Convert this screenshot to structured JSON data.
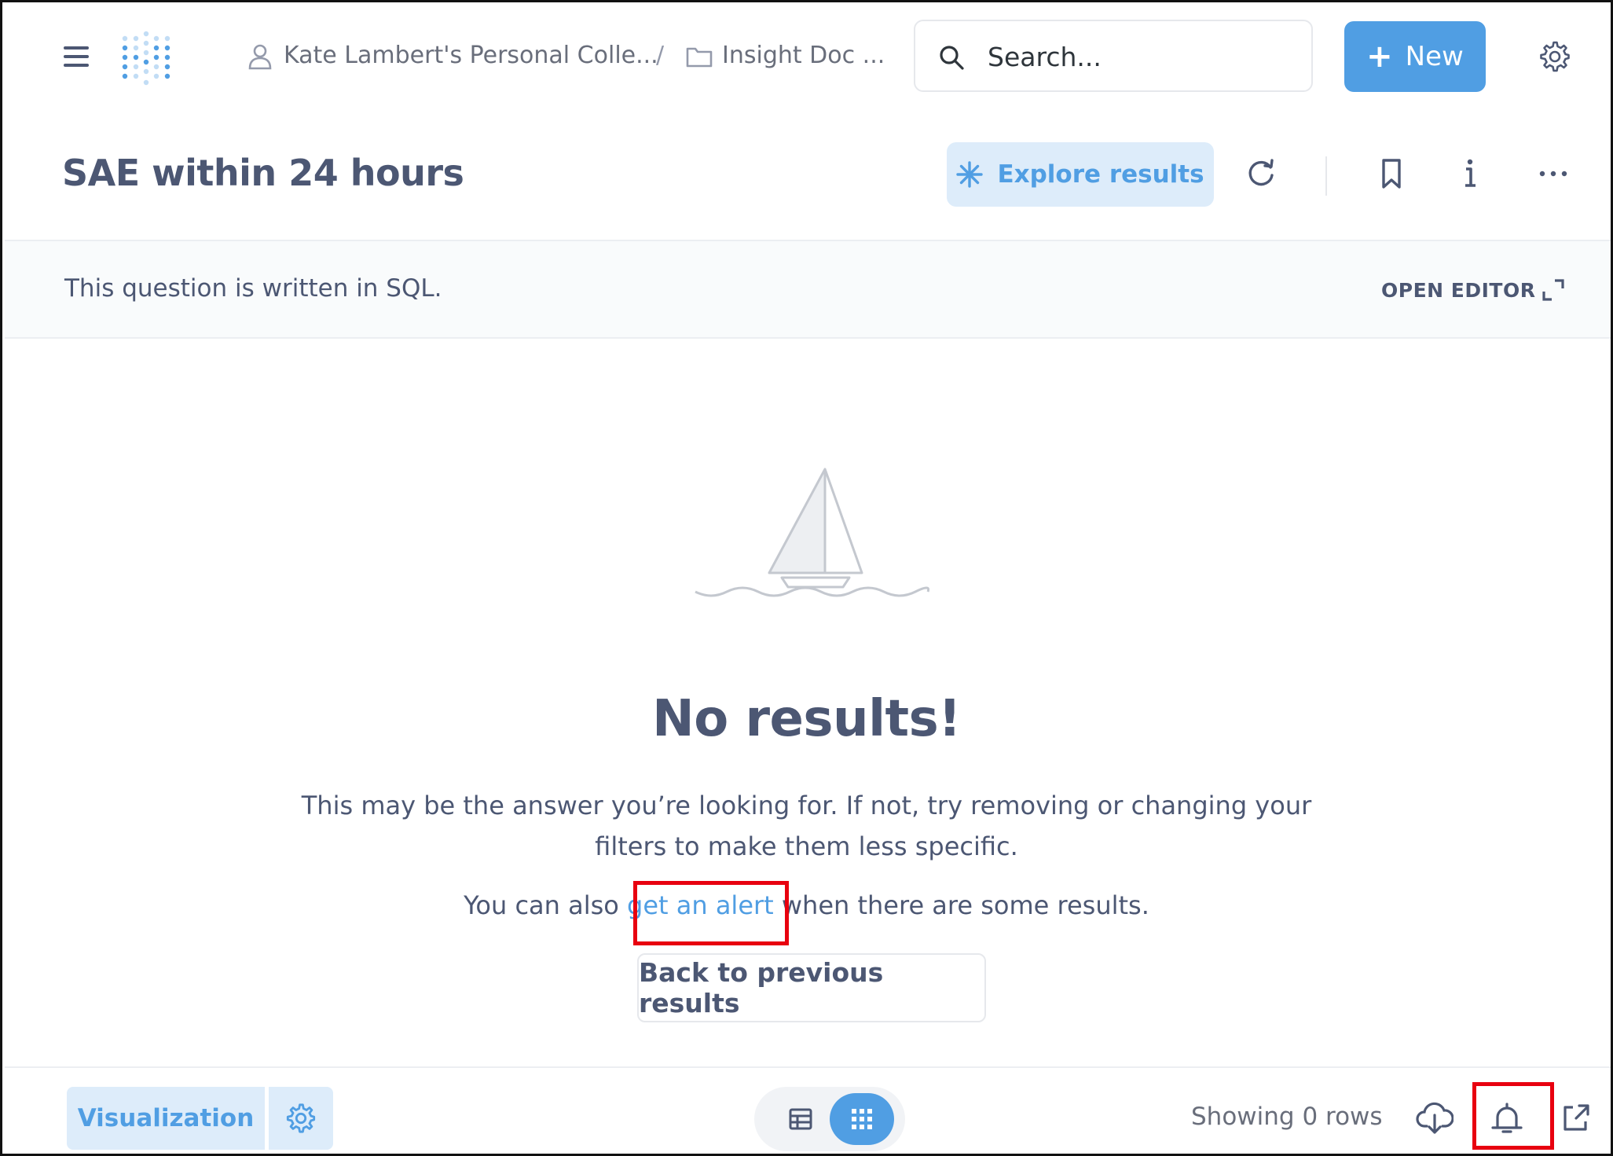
{
  "nav": {
    "breadcrumb": {
      "collection": "Kate Lambert's Personal Colle...",
      "separator": "/",
      "folder": "Insight Doc ..."
    },
    "search": {
      "placeholder": "Search..."
    },
    "new_label": "New"
  },
  "header": {
    "title": "SAE within 24 hours",
    "explore_label": "Explore results"
  },
  "sql_bar": {
    "text": "This question is written in SQL.",
    "open_editor": "OPEN EDITOR"
  },
  "empty_state": {
    "heading": "No results!",
    "desc_line1": "This may be the answer you’re looking for. If not, try removing or changing your",
    "desc_line2": "filters to make them less specific.",
    "alert_prefix": "You can also ",
    "alert_link": "get an alert",
    "alert_suffix": " when there are some results.",
    "back_label": "Back to previous results"
  },
  "footer": {
    "visualization_label": "Visualization",
    "row_count": "Showing 0 rows"
  },
  "colors": {
    "brand": "#509ee3",
    "brand_light": "#ddecfa",
    "text_dark": "#4c5773",
    "text_medium": "#696e7b",
    "highlight": "#e8000f"
  },
  "icons": [
    "menu-icon",
    "metabase-logo",
    "person-icon",
    "folder-icon",
    "search-icon",
    "plus-icon",
    "gear-icon",
    "sparkle-icon",
    "refresh-icon",
    "bookmark-icon",
    "info-icon",
    "ellipsis-icon",
    "expand-icon",
    "sailboat-illustration",
    "table-icon",
    "grid-icon",
    "download-icon",
    "bell-icon",
    "share-icon"
  ]
}
